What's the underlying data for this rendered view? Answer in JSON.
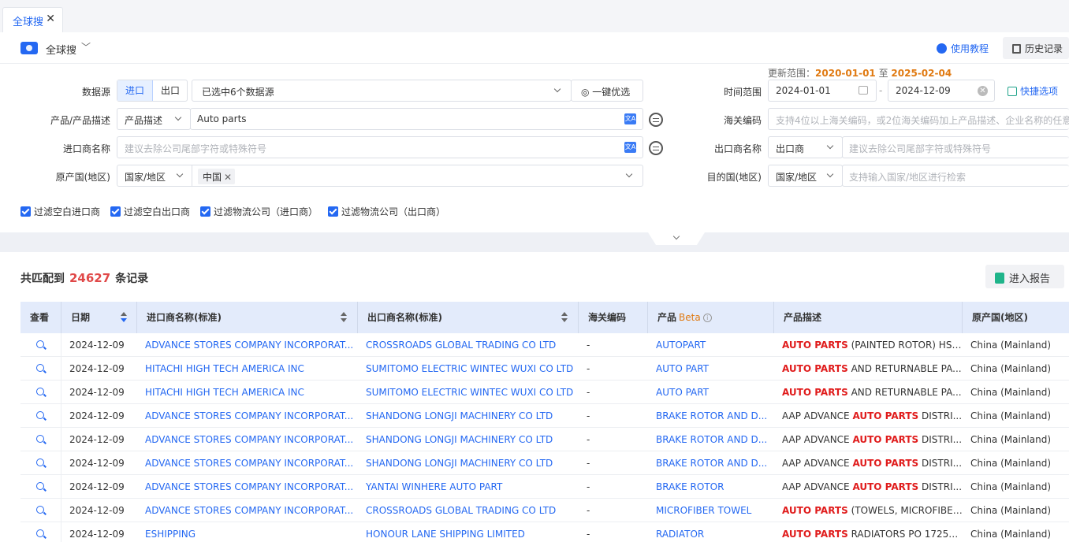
{
  "tab": {
    "label": "全球搜",
    "close": "✕"
  },
  "header": {
    "title": "全球搜",
    "tutorial": "使用教程",
    "history": "历史记录"
  },
  "filters": {
    "range_note_prefix": "更新范围：",
    "range_start": "2020-01-01",
    "range_sep": " 至 ",
    "range_end": "2025-02-04",
    "datasource_label": "数据源",
    "import_btn": "进口",
    "export_btn": "出口",
    "datasource_value": "已选中6个数据源",
    "one_click": "一键优选",
    "time_label": "时间范围",
    "date_from": "2024-01-01",
    "date_sep": "-",
    "date_to": "2024-12-09",
    "quick_options": "快捷选项",
    "product_label": "产品/产品描述",
    "product_type": "产品描述",
    "product_value": "Auto parts",
    "hscode_label": "海关编码",
    "hscode_placeholder": "支持4位以上海关编码，或2位海关编码加上产品描述、企业名称的任意",
    "importer_label": "进口商名称",
    "importer_placeholder": "建议去除公司尾部字符或特殊符号",
    "exporter_label": "出口商名称",
    "exporter_type": "出口商",
    "exporter_placeholder": "建议去除公司尾部字符或特殊符号",
    "origin_label": "原产国(地区)",
    "origin_type": "国家/地区",
    "origin_chip": "中国",
    "dest_label": "目的国(地区)",
    "dest_type": "国家/地区",
    "dest_placeholder": "支持输入国家/地区进行检索",
    "checkboxes": [
      "过滤空白进口商",
      "过滤空白出口商",
      "过滤物流公司（进口商）",
      "过滤物流公司（出口商）"
    ]
  },
  "results": {
    "count_prefix": "共匹配到",
    "count": "24627",
    "count_suffix": "条记录",
    "report_btn": "进入报告",
    "columns": {
      "view": "查看",
      "date": "日期",
      "importer": "进口商名称(标准)",
      "exporter": "出口商名称(标准)",
      "hscode": "海关编码",
      "product": "产品",
      "beta": "Beta",
      "desc": "产品描述",
      "origin": "原产国(地区)"
    },
    "rows": [
      {
        "date": "2024-12-09",
        "importer": "ADVANCE STORES COMPANY INCORPORAT...",
        "exporter": "CROSSROADS GLOBAL TRADING CO LTD",
        "hscode": "-",
        "product": "AUTOPART",
        "desc_pre": "",
        "desc_hl": "AUTO PARTS",
        "desc_post": " (PAINTED ROTOR) HS ...",
        "origin": "China (Mainland)"
      },
      {
        "date": "2024-12-09",
        "importer": "HITACHI HIGH TECH AMERICA INC",
        "exporter": "SUMITOMO ELECTRIC WINTEC WUXI CO LTD",
        "hscode": "-",
        "product": "AUTO PART",
        "desc_pre": "",
        "desc_hl": "AUTO PARTS",
        "desc_post": " AND RETURNABLE PA...",
        "origin": "China (Mainland)"
      },
      {
        "date": "2024-12-09",
        "importer": "HITACHI HIGH TECH AMERICA INC",
        "exporter": "SUMITOMO ELECTRIC WINTEC WUXI CO LTD",
        "hscode": "-",
        "product": "AUTO PART",
        "desc_pre": "",
        "desc_hl": "AUTO PARTS",
        "desc_post": " AND RETURNABLE PA...",
        "origin": "China (Mainland)"
      },
      {
        "date": "2024-12-09",
        "importer": "ADVANCE STORES COMPANY INCORPORAT...",
        "exporter": "SHANDONG LONGJI MACHINERY CO LTD",
        "hscode": "-",
        "product": "BRAKE ROTOR AND D...",
        "desc_pre": "AAP ADVANCE ",
        "desc_hl": "AUTO PARTS",
        "desc_post": " DISTRI...",
        "origin": "China (Mainland)"
      },
      {
        "date": "2024-12-09",
        "importer": "ADVANCE STORES COMPANY INCORPORAT...",
        "exporter": "SHANDONG LONGJI MACHINERY CO LTD",
        "hscode": "-",
        "product": "BRAKE ROTOR AND D...",
        "desc_pre": "AAP ADVANCE ",
        "desc_hl": "AUTO PARTS",
        "desc_post": " DISTRI...",
        "origin": "China (Mainland)"
      },
      {
        "date": "2024-12-09",
        "importer": "ADVANCE STORES COMPANY INCORPORAT...",
        "exporter": "SHANDONG LONGJI MACHINERY CO LTD",
        "hscode": "-",
        "product": "BRAKE ROTOR AND D...",
        "desc_pre": "AAP ADVANCE ",
        "desc_hl": "AUTO PARTS",
        "desc_post": " DISTRI...",
        "origin": "China (Mainland)"
      },
      {
        "date": "2024-12-09",
        "importer": "ADVANCE STORES COMPANY INCORPORAT...",
        "exporter": "YANTAI WINHERE AUTO PART",
        "hscode": "-",
        "product": "BRAKE ROTOR",
        "desc_pre": "AAP ADVANCE ",
        "desc_hl": "AUTO PARTS",
        "desc_post": " DISTRI...",
        "origin": "China (Mainland)"
      },
      {
        "date": "2024-12-09",
        "importer": "ADVANCE STORES COMPANY INCORPORAT...",
        "exporter": "CROSSROADS GLOBAL TRADING CO LTD",
        "hscode": "-",
        "product": "MICROFIBER TOWEL",
        "desc_pre": "",
        "desc_hl": "AUTO PARTS",
        "desc_post": " (TOWELS, MICROFIBER...",
        "origin": "China (Mainland)"
      },
      {
        "date": "2024-12-09",
        "importer": "ESHIPPING",
        "exporter": "HONOUR LANE SHIPPING LIMITED",
        "hscode": "-",
        "product": "RADIATOR",
        "desc_pre": "",
        "desc_hl": "AUTO PARTS",
        "desc_post": " RADIATORS PO 17252...",
        "origin": "China (Mainland)"
      }
    ]
  }
}
